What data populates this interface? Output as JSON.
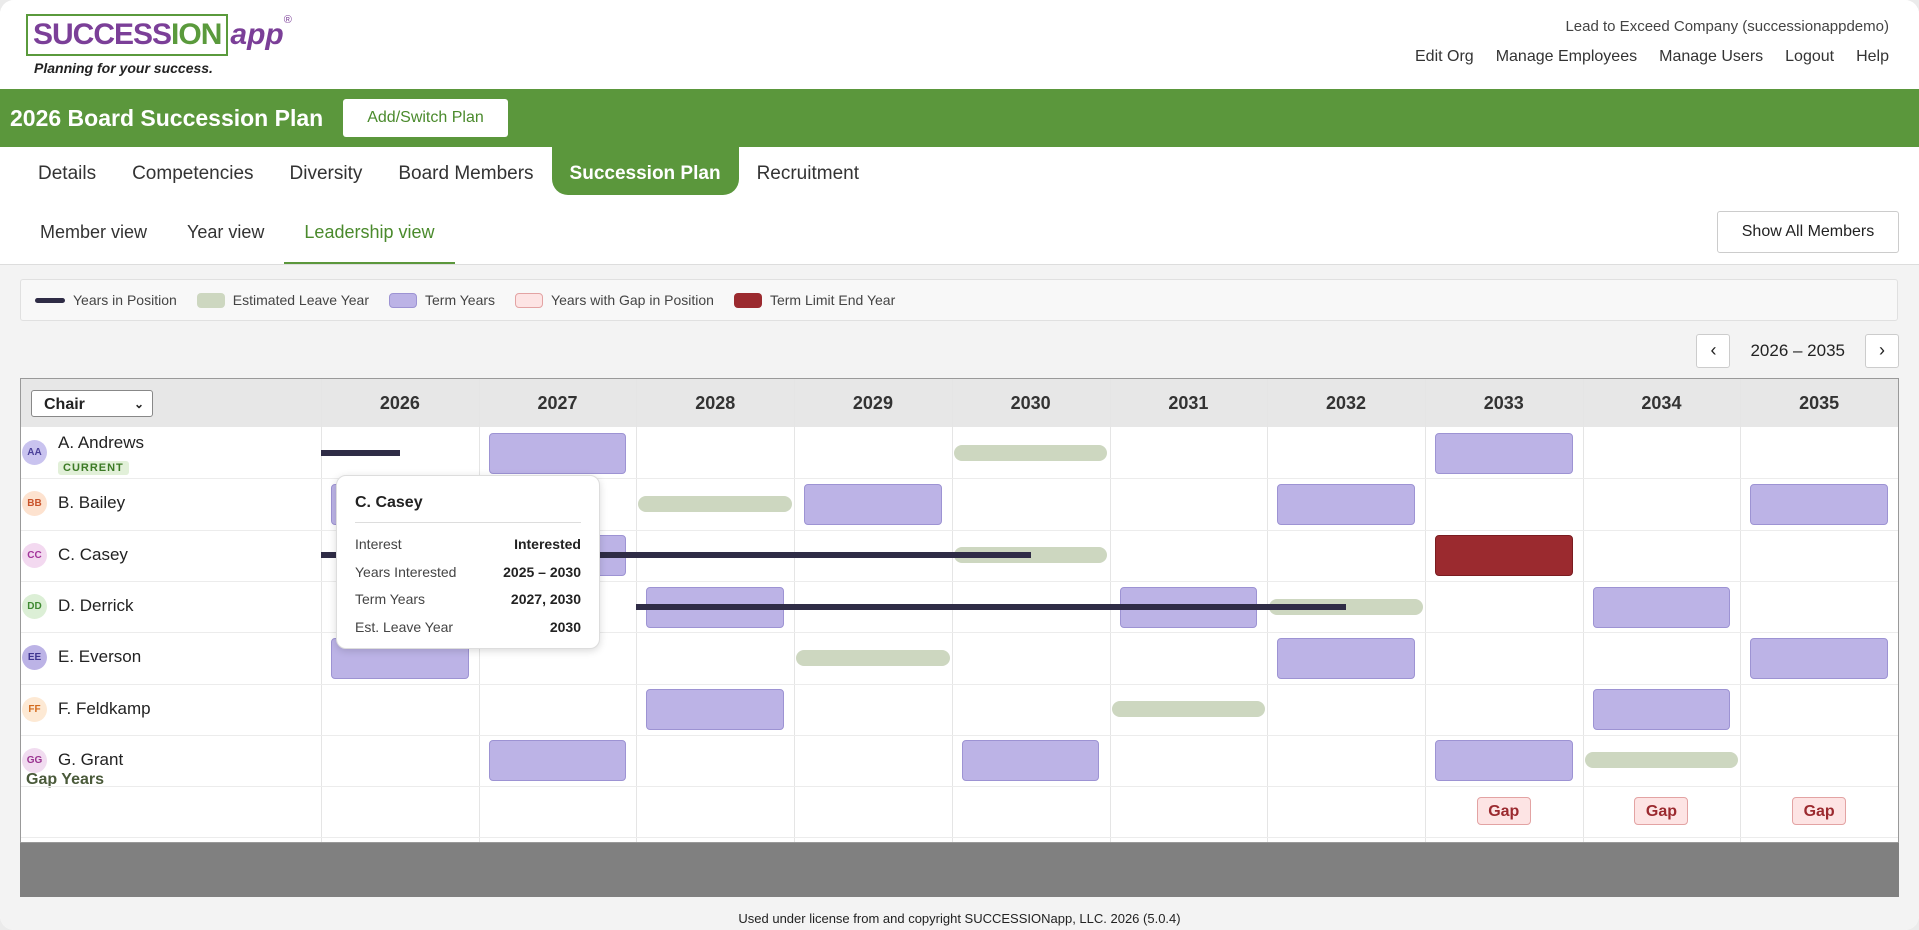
{
  "app": {
    "logo_main": "SUCCESS",
    "logo_o": "ION",
    "logo_app": "app",
    "logo_reg": "®",
    "tagline": "Planning for your success.",
    "company": "Lead to Exceed Company (successionappdemo)",
    "nav": [
      "Edit Org",
      "Manage Employees",
      "Manage Users",
      "Logout",
      "Help"
    ]
  },
  "plan": {
    "title": "2026 Board Succession Plan",
    "add_switch": "Add/Switch Plan"
  },
  "tabs": [
    "Details",
    "Competencies",
    "Diversity",
    "Board Members",
    "Succession Plan",
    "Recruitment"
  ],
  "subtabs": [
    "Member view",
    "Year view",
    "Leadership view"
  ],
  "show_all": "Show All Members",
  "legend": [
    "Years in Position",
    "Estimated Leave Year",
    "Term Years",
    "Years with Gap in Position",
    "Term Limit End Year"
  ],
  "colors": {
    "brand_green": "#5b973c",
    "term": "#bcb3e6",
    "leave": "#cdd7c0",
    "position": "#2f2c46",
    "gap": "#fde4e4",
    "limit": "#9b2a2f"
  },
  "range": {
    "label": "2026 – 2035",
    "prev": "‹",
    "next": "›"
  },
  "grid": {
    "role": "Chair",
    "role_chevron": "⌄",
    "years": [
      2026,
      2027,
      2028,
      2029,
      2030,
      2031,
      2032,
      2033,
      2034,
      2035
    ],
    "gap_label": "Gap Years",
    "gap_years": [
      2033,
      2034,
      2035
    ],
    "gap_text": "Gap",
    "current_badge": "CURRENT",
    "members": [
      {
        "initials": "AA",
        "name": "A. Andrews",
        "avatar_bg": "#c9c3ef",
        "avatar_fg": "#4a3f99",
        "current": true,
        "term_years": [
          2027,
          2033
        ],
        "leave_years": [
          2030
        ],
        "limit_years": [],
        "position": [
          2026,
          2026.5
        ]
      },
      {
        "initials": "BB",
        "name": "B. Bailey",
        "avatar_bg": "#fde2cf",
        "avatar_fg": "#c9532a",
        "current": false,
        "term_years": [
          2026,
          2029,
          2032,
          2035
        ],
        "leave_years": [
          2028
        ],
        "limit_years": [],
        "position": null
      },
      {
        "initials": "CC",
        "name": "C. Casey",
        "avatar_bg": "#f3d9f0",
        "avatar_fg": "#a3349a",
        "current": false,
        "term_years": [
          2027
        ],
        "leave_years": [
          2030
        ],
        "limit_years": [
          2033
        ],
        "position": [
          2026,
          2030.5
        ]
      },
      {
        "initials": "DD",
        "name": "D. Derrick",
        "avatar_bg": "#dcefd6",
        "avatar_fg": "#3f8a32",
        "current": false,
        "term_years": [
          2028,
          2031,
          2034
        ],
        "leave_years": [
          2032
        ],
        "limit_years": [],
        "position": [
          2028,
          2032.5
        ]
      },
      {
        "initials": "EE",
        "name": "E. Everson",
        "avatar_bg": "#bcb3e6",
        "avatar_fg": "#3f3590",
        "current": false,
        "term_years": [
          2026,
          2032,
          2035
        ],
        "leave_years": [
          2029
        ],
        "limit_years": [],
        "position": null
      },
      {
        "initials": "FF",
        "name": "F. Feldkamp",
        "avatar_bg": "#fde9d4",
        "avatar_fg": "#d36a1c",
        "current": false,
        "term_years": [
          2028,
          2034
        ],
        "leave_years": [
          2031
        ],
        "limit_years": [],
        "position": null
      },
      {
        "initials": "GG",
        "name": "G. Grant",
        "avatar_bg": "#f1dcf0",
        "avatar_fg": "#9a3390",
        "current": false,
        "term_years": [
          2027,
          2030,
          2033
        ],
        "leave_years": [
          2034
        ],
        "limit_years": [],
        "position": null
      }
    ]
  },
  "tooltip": {
    "name": "C. Casey",
    "rows": [
      {
        "k": "Interest",
        "v": "Interested"
      },
      {
        "k": "Years Interested",
        "v": "2025 – 2030"
      },
      {
        "k": "Term Years",
        "v": "2027, 2030"
      },
      {
        "k": "Est. Leave Year",
        "v": "2030"
      }
    ]
  },
  "footer": "Used under license from and copyright SUCCESSIONapp, LLC. 2026 (5.0.4)"
}
